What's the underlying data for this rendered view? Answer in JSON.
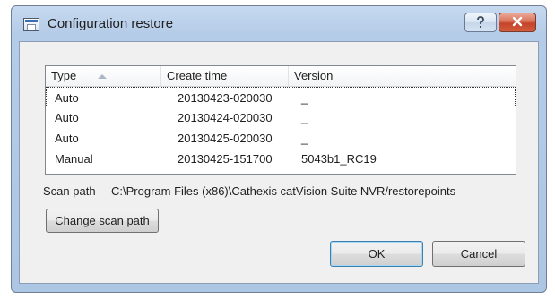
{
  "window": {
    "title": "Configuration restore",
    "help_label": "?",
    "close_label": "x"
  },
  "table": {
    "columns": [
      "Type",
      "Create time",
      "Version"
    ],
    "sorted_column": "Type",
    "rows": [
      {
        "type": "Auto",
        "create_time": "20130423-020030",
        "version": "_"
      },
      {
        "type": "Auto",
        "create_time": "20130424-020030",
        "version": "_"
      },
      {
        "type": "Auto",
        "create_time": "20130425-020030",
        "version": "_"
      },
      {
        "type": "Manual",
        "create_time": "20130425-151700",
        "version": "5043b1_RC19"
      }
    ],
    "selected_row_index": 0
  },
  "scan": {
    "label": "Scan path",
    "path": "C:\\Program Files (x86)\\Cathexis catVision Suite NVR/restorepoints"
  },
  "buttons": {
    "change_scan_path": "Change scan path",
    "ok": "OK",
    "cancel": "Cancel"
  }
}
